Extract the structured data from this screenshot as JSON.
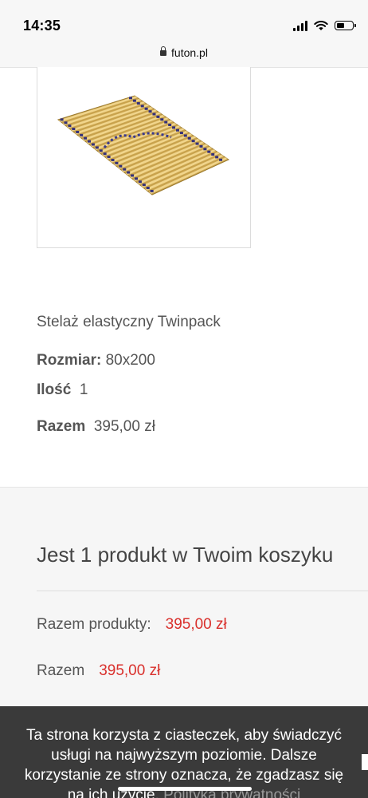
{
  "status_bar": {
    "time": "14:35",
    "icons": [
      "signal-icon",
      "wifi-icon",
      "battery-icon"
    ]
  },
  "browser": {
    "url": "futon.pl",
    "lock_icon": "lock-icon"
  },
  "product": {
    "image": "slatted-bed-base-image",
    "name": "Stelaż elastyczny Twinpack",
    "size_label": "Rozmiar:",
    "size_value": "80x200",
    "qty_label": "Ilość",
    "qty_value": "1",
    "total_label": "Razem",
    "total_value": "395,00 zł"
  },
  "cart": {
    "title": "Jest 1 produkt w Twoim koszyku",
    "products_label": "Razem produkty:",
    "products_value": "395,00 zł",
    "total_label": "Razem",
    "total_value": "395,00 zł",
    "price_color": "#d9302c"
  },
  "cookie_banner": {
    "line1": "Ta strona korzysta z ciasteczek, aby świadczyć",
    "line2": "usługi na najwyższym poziomie. Dalsze",
    "line3": "korzystanie ze strony oznacza, że zgadzasz się",
    "line4_start": "na ich użycie.",
    "policy_link": "Polityka prywatności",
    "background": "#3a3a3a"
  }
}
